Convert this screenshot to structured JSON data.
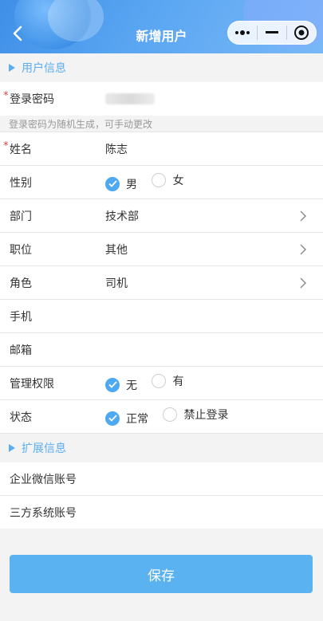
{
  "header": {
    "title": "新增用户",
    "capsule": {
      "more_icon": "more-dots-icon",
      "minimize_icon": "minimize-icon",
      "close_icon": "target-close-icon"
    }
  },
  "sections": {
    "user_info": "用户信息",
    "ext_info": "扩展信息"
  },
  "fields": {
    "password": {
      "label": "登录密码",
      "required": "*",
      "hint": "登录密码为随机生成，可手动更改"
    },
    "name": {
      "label": "姓名",
      "required": "*",
      "value": "陈志"
    },
    "gender": {
      "label": "性别",
      "options": [
        "男",
        "女"
      ],
      "selected": "男"
    },
    "department": {
      "label": "部门",
      "value": "技术部"
    },
    "position": {
      "label": "职位",
      "value": "其他"
    },
    "role": {
      "label": "角色",
      "value": "司机"
    },
    "phone": {
      "label": "手机",
      "value": ""
    },
    "email": {
      "label": "邮箱",
      "value": ""
    },
    "admin": {
      "label": "管理权限",
      "options": [
        "无",
        "有"
      ],
      "selected": "无"
    },
    "status": {
      "label": "状态",
      "options": [
        "正常",
        "禁止登录"
      ],
      "selected": "正常"
    },
    "wecom": {
      "label": "企业微信账号",
      "value": ""
    },
    "third": {
      "label": "三方系统账号",
      "value": ""
    }
  },
  "save_label": "保存",
  "colors": {
    "accent": "#4ea9f0",
    "section_text": "#5aaef3",
    "required": "#e04040"
  }
}
